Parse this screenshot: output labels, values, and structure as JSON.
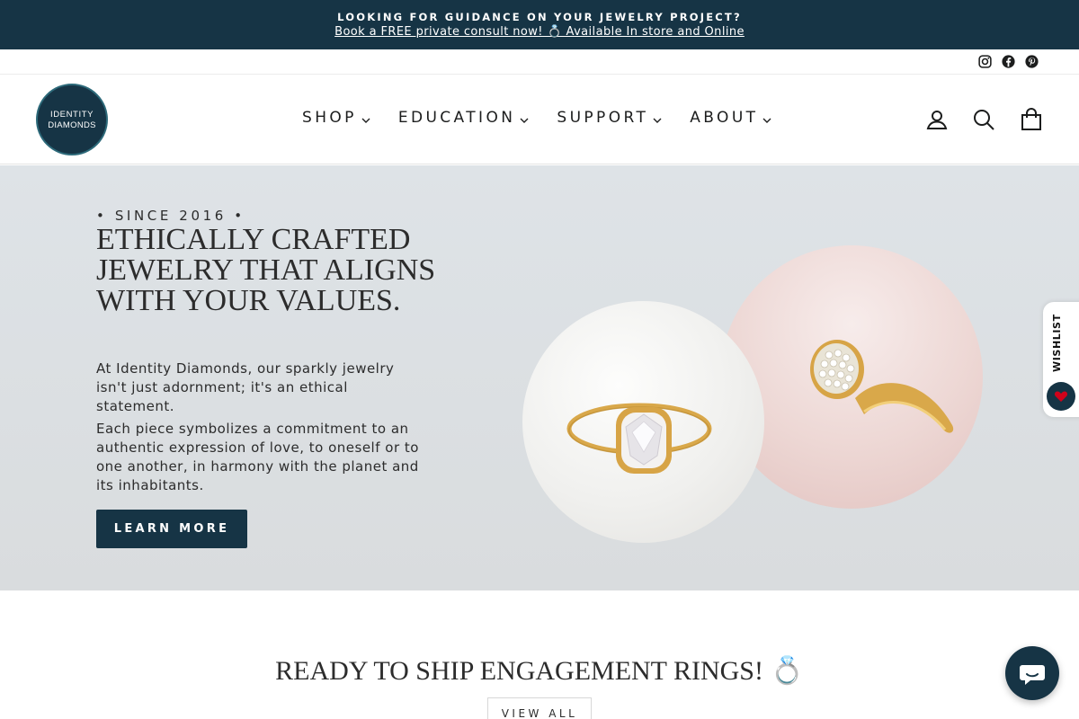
{
  "announcement": {
    "title": "LOOKING FOR GUIDANCE ON YOUR JEWELRY PROJECT?",
    "link": "Book a FREE private consult now! 💍 Available In store and Online"
  },
  "social": [
    "instagram-icon",
    "facebook-icon",
    "pinterest-icon"
  ],
  "logo": {
    "line1": "IDENTITY",
    "line2": "DIAMONDS"
  },
  "nav": {
    "items": [
      {
        "label": "SHOP"
      },
      {
        "label": "EDUCATION"
      },
      {
        "label": "SUPPORT"
      },
      {
        "label": "ABOUT"
      }
    ],
    "icons": [
      "account-icon",
      "search-icon",
      "cart-icon"
    ]
  },
  "hero": {
    "eyebrow": "• SINCE 2016 •",
    "title": "ETHICALLY CRAFTED JEWELRY THAT ALIGNS WITH YOUR VALUES.",
    "paragraph1": "At Identity Diamonds, our sparkly jewelry isn't just adornment; it's an ethical statement.",
    "paragraph2": "Each piece symbolizes a commitment to an authentic expression of love, to oneself or to one another, in harmony with the planet and its inhabitants.",
    "cta": "LEARN MORE"
  },
  "wishlist": {
    "label": "WISHLIST"
  },
  "featured": {
    "title": "READY TO SHIP ENGAGEMENT RINGS! 💍",
    "view_all": "VIEW ALL"
  },
  "colors": {
    "brand": "#163445",
    "hero_bg": "#dee3e7",
    "wishlist_heart": "#d0021b"
  }
}
